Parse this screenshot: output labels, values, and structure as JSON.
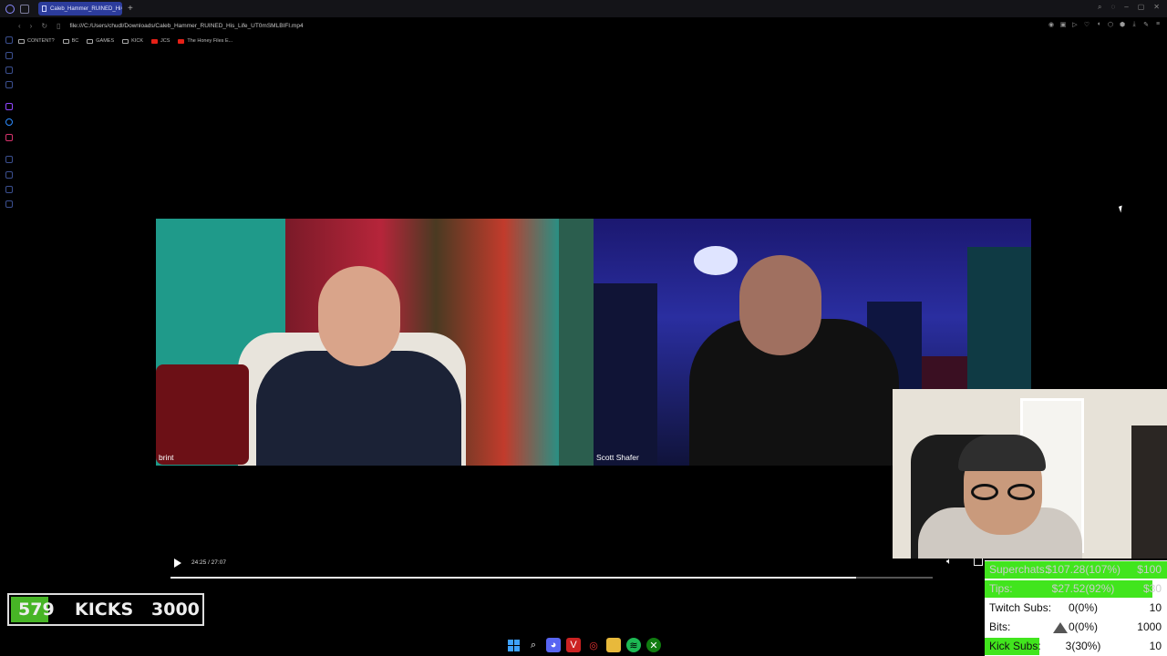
{
  "browser": {
    "tab_title": "Caleb_Hammer_RUINED_Hi",
    "url": "file:///C:/Users/chudl/Downloads/Caleb_Hammer_RUINED_His_Life_UT0mSMLBIFI.mp4",
    "bookmarks": [
      "CONTENT?",
      "BC",
      "GAMES",
      "KICK",
      "JCS",
      "The Honey Files E..."
    ]
  },
  "video": {
    "participant_left": "brint",
    "participant_right": "Scott Shafer",
    "time": "24:25 / 27:07",
    "progress": 0.9
  },
  "kicks_goal": {
    "current": "579",
    "label": "KICKS",
    "goal": "3000",
    "progress": 0.193
  },
  "stats": [
    {
      "label": "Superchats:",
      "amount": "$107.28(107%)",
      "goal": "$100",
      "progress": 1.0,
      "icon": ""
    },
    {
      "label": "Tips:",
      "amount": "$27.52(92%)",
      "goal": "$30",
      "progress": 0.92,
      "icon": ""
    },
    {
      "label": "Twitch Subs:",
      "amount": "0(0%)",
      "goal": "10",
      "progress": 0,
      "icon": ""
    },
    {
      "label": "Bits:",
      "amount": "0(0%)",
      "goal": "1000",
      "progress": 0,
      "icon": "bits-icon"
    },
    {
      "label": "Kick Subs:",
      "amount": "3(30%)",
      "goal": "10",
      "progress": 0.3,
      "icon": ""
    }
  ],
  "colors": {
    "accent_green": "#41e51d",
    "kick_green": "#47b526",
    "tab_blue": "#2c3c9c"
  }
}
